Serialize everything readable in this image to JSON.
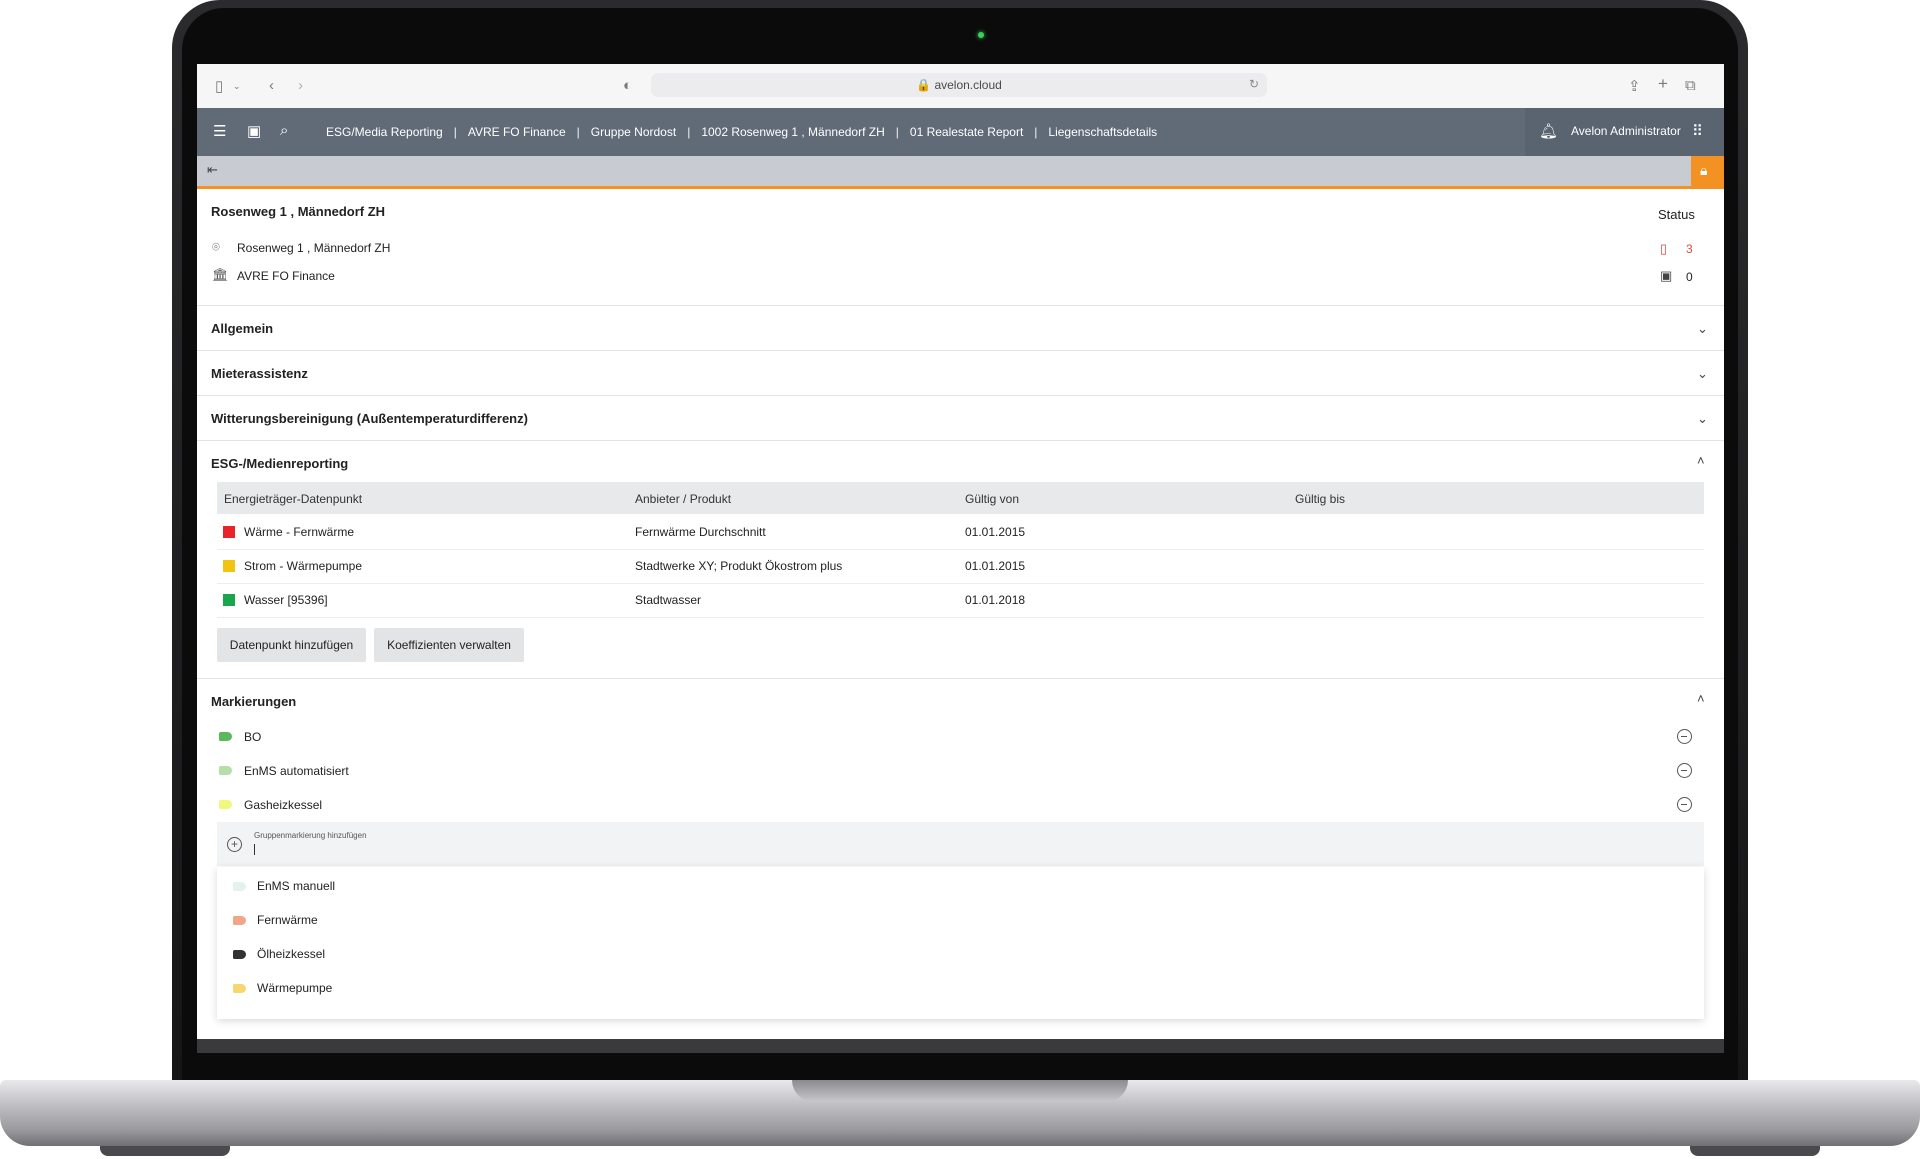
{
  "browser": {
    "url": "avelon.cloud"
  },
  "nav": {
    "breadcrumbs": [
      "ESG/Media Reporting",
      "AVRE FO Finance",
      "Gruppe Nordost",
      "1002 Rosenweg 1 , Männedorf ZH",
      "01 Realestate Report",
      "Liegenschaftsdetails"
    ],
    "separator": "|",
    "user": "Avelon Administrator"
  },
  "property": {
    "title": "Rosenweg 1 , Männedorf ZH",
    "address": "Rosenweg 1 , Männedorf ZH",
    "owner": "AVRE FO Finance",
    "status_label": "Status",
    "alarm_count": "3",
    "ticket_count": "0",
    "alarm_color": "#e04646"
  },
  "sections": {
    "allgemein": "Allgemein",
    "mieter": "Mieterassistenz",
    "witterung": "Witterungsbereinigung (Außentemperaturdifferenz)",
    "esg": "ESG-/Medienreporting",
    "markierungen": "Markierungen"
  },
  "esg_table": {
    "headers": [
      "Energieträger-Datenpunkt",
      "Anbieter / Produkt",
      "Gültig von",
      "Gültig bis"
    ],
    "rows": [
      {
        "datapoint": "Wärme - Fernwärme",
        "provider": "Fernwärme Durchschnitt",
        "valid_from": "01.01.2015",
        "valid_to": "",
        "color": "#e8232a"
      },
      {
        "datapoint": "Strom - Wärmepumpe",
        "provider": "Stadtwerke XY; Produkt Ökostrom plus",
        "valid_from": "01.01.2015",
        "valid_to": "",
        "color": "#f1c40f"
      },
      {
        "datapoint": "Wasser [95396]",
        "provider": "Stadtwasser",
        "valid_from": "01.01.2018",
        "valid_to": "",
        "color": "#1aa54b"
      }
    ],
    "add_button": "Datenpunkt hinzufügen",
    "coeff_button": "Koeffizienten verwalten"
  },
  "tags": {
    "items": [
      {
        "label": "BO",
        "color": "#5cb85c"
      },
      {
        "label": "EnMS automatisiert",
        "color": "#b5dfa9"
      },
      {
        "label": "Gasheizkessel",
        "color": "#f2f77e"
      }
    ],
    "add_label": "Gruppenmarkierung hinzufügen",
    "options": [
      {
        "label": "EnMS manuell",
        "color": "#e4f2ef"
      },
      {
        "label": "Fernwärme",
        "color": "#f3a58a"
      },
      {
        "label": "Ölheizkessel",
        "color": "#333333"
      },
      {
        "label": "Wärmepumpe",
        "color": "#f5d76e"
      }
    ]
  },
  "colors": {
    "accent": "#f39223",
    "navbar": "#616b78"
  }
}
